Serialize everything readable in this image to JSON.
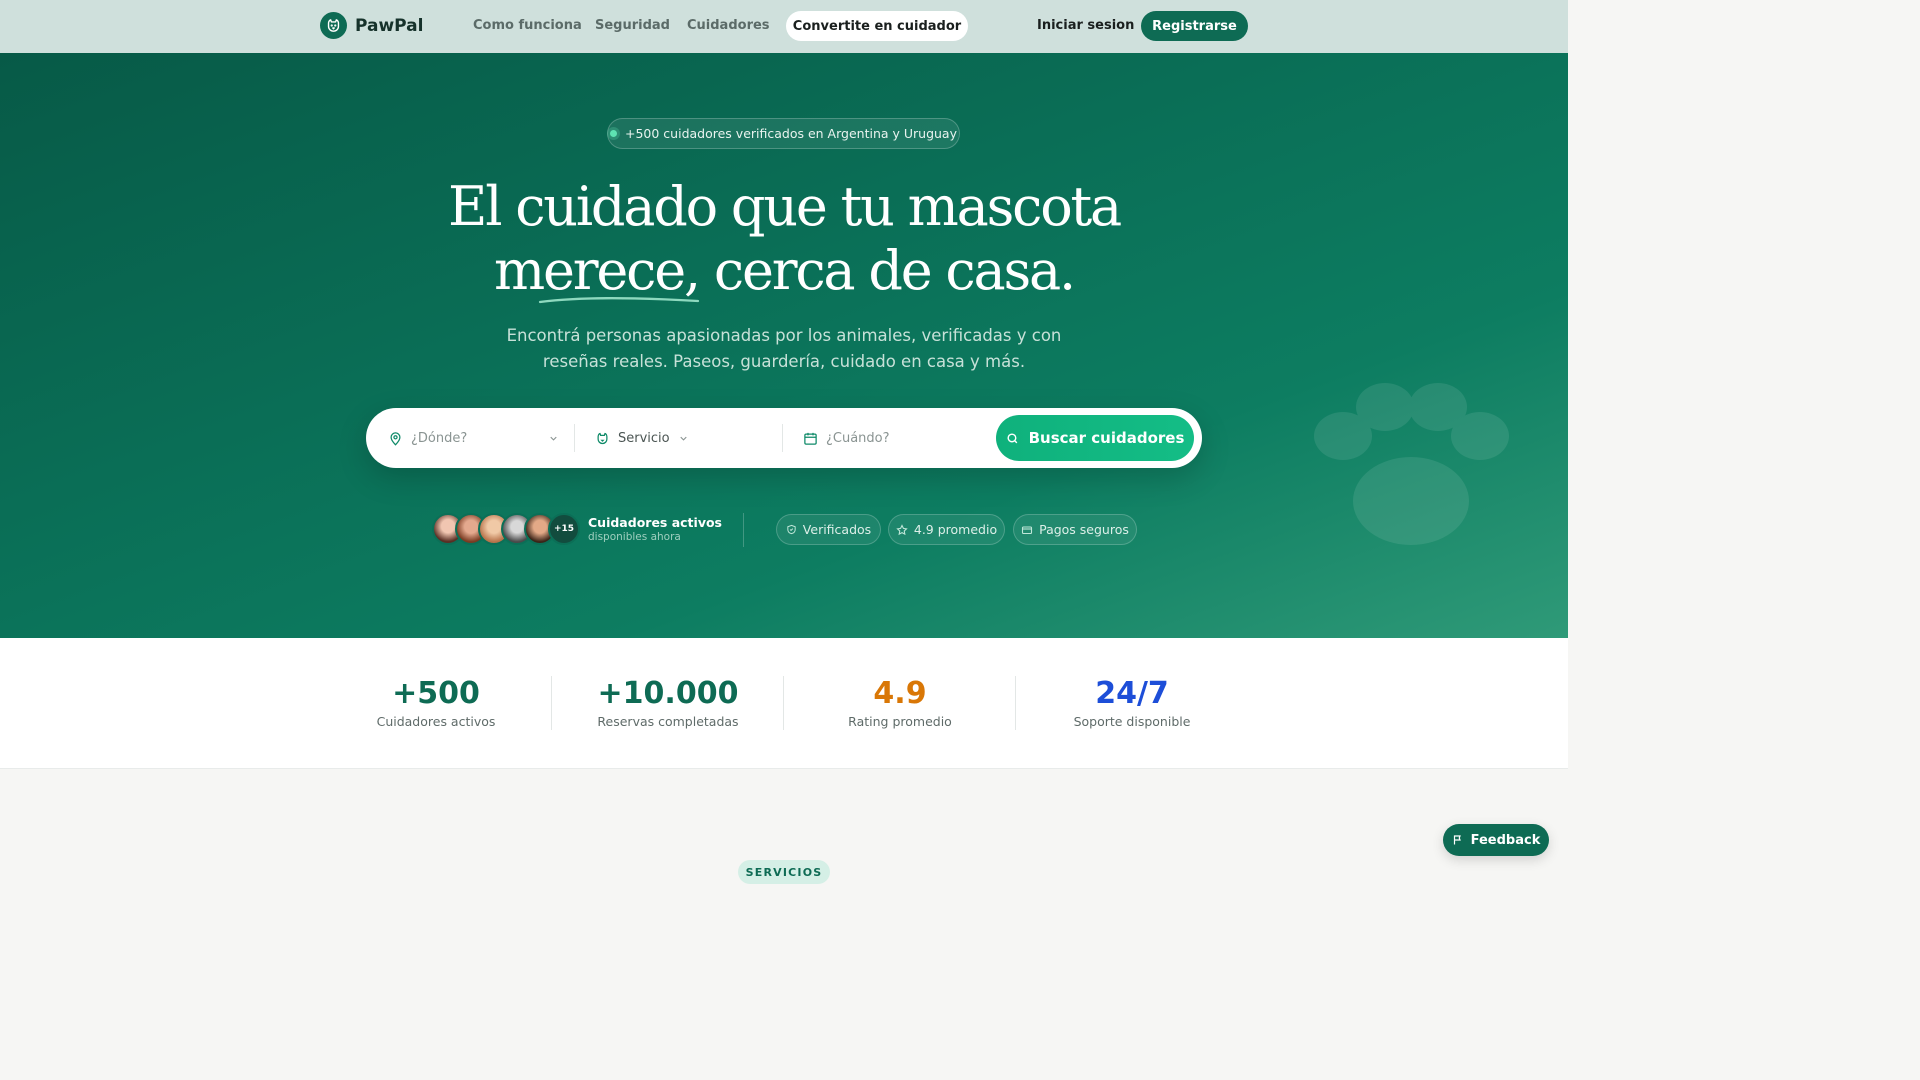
{
  "nav": {
    "brand": "PawPal",
    "links": [
      "Como funciona",
      "Seguridad",
      "Cuidadores"
    ],
    "cta_caregiver": "Convertite en cuidador",
    "login": "Iniciar sesion",
    "register": "Registrarse"
  },
  "hero": {
    "pill": "+500 cuidadores verificados en Argentina y Uruguay",
    "headline_line1": "El cuidado que tu mascota",
    "headline_word": "merece",
    "headline_rest": ", cerca de casa.",
    "subtitle": "Encontrá personas apasionadas por los animales, verificadas y con reseñas reales. Paseos, guardería, cuidado en casa y más.",
    "search": {
      "where_placeholder": "¿Dónde?",
      "service_value": "Servicio",
      "when_placeholder": "¿Cuándo?",
      "button": "Buscar cuidadores"
    },
    "active": {
      "more": "+15",
      "title": "Cuidadores activos",
      "subtitle": "disponibles ahora"
    },
    "badges": [
      "Verificados",
      "4.9 promedio",
      "Pagos seguros"
    ]
  },
  "stats": [
    {
      "value": "+500",
      "label": "Cuidadores activos",
      "color": "#0e6b54"
    },
    {
      "value": "+10.000",
      "label": "Reservas completadas",
      "color": "#0e6b54"
    },
    {
      "value": "4.9",
      "label": "Rating promedio",
      "color": "#d97706"
    },
    {
      "value": "24/7",
      "label": "Soporte disponible",
      "color": "#1d4ed8"
    }
  ],
  "section_badge": "SERVICIOS",
  "feedback": "Feedback",
  "colors": {
    "brand": "#0e6b54",
    "accent": "#10b981"
  }
}
